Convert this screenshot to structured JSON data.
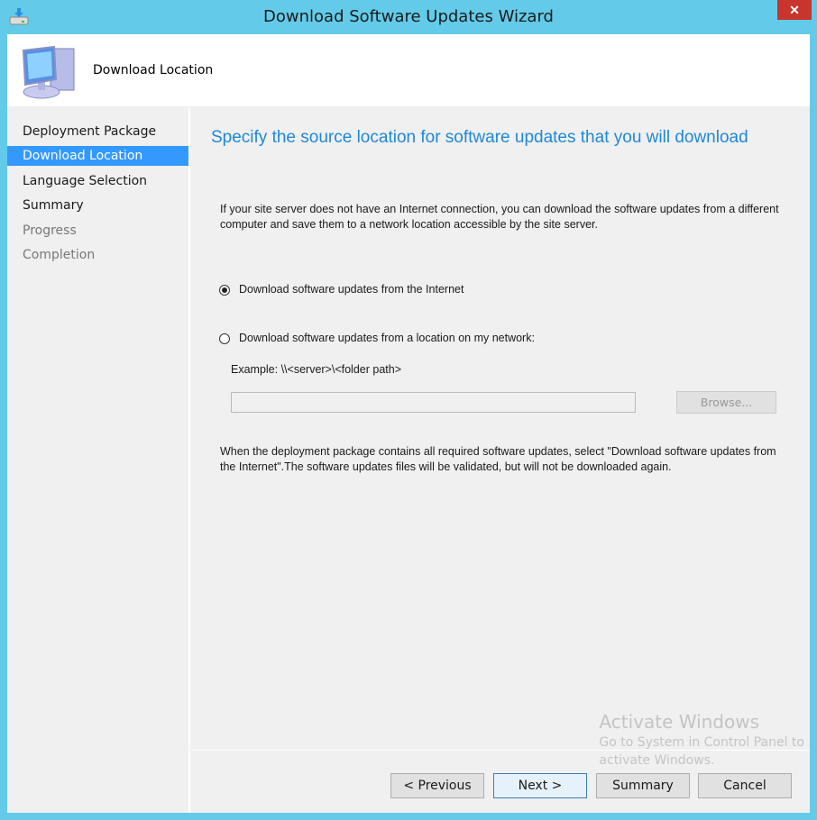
{
  "window": {
    "title": "Download Software Updates Wizard",
    "close_label": "✕"
  },
  "header": {
    "title": "Download Location"
  },
  "sidebar": {
    "items": [
      {
        "label": "Deployment Package",
        "state": "normal"
      },
      {
        "label": "Download Location",
        "state": "selected"
      },
      {
        "label": "Language Selection",
        "state": "normal"
      },
      {
        "label": "Summary",
        "state": "normal"
      },
      {
        "label": "Progress",
        "state": "disabled"
      },
      {
        "label": "Completion",
        "state": "disabled"
      }
    ]
  },
  "main": {
    "heading": "Specify the source location for software updates that you will download",
    "intro": "If your site server does not have an Internet connection, you can download the software updates from a different computer and save them to a network location accessible by the site server.",
    "option_internet": {
      "label": "Download software updates from the Internet",
      "selected": true
    },
    "option_network": {
      "label": "Download software updates from a location on my network:",
      "selected": false
    },
    "example": "Example: \\\\<server>\\<folder path>",
    "path_value": "",
    "browse_label": "Browse...",
    "note": "When the deployment package contains all required software updates, select \"Download  software updates from the Internet\".The software updates files will be validated, but will not be downloaded again."
  },
  "buttons": {
    "previous": "< Previous",
    "next": "Next >",
    "summary": "Summary",
    "cancel": "Cancel"
  },
  "watermark": {
    "line1": "Activate Windows",
    "line2": "Go to System in Control Panel to",
    "line3": "activate Windows."
  }
}
